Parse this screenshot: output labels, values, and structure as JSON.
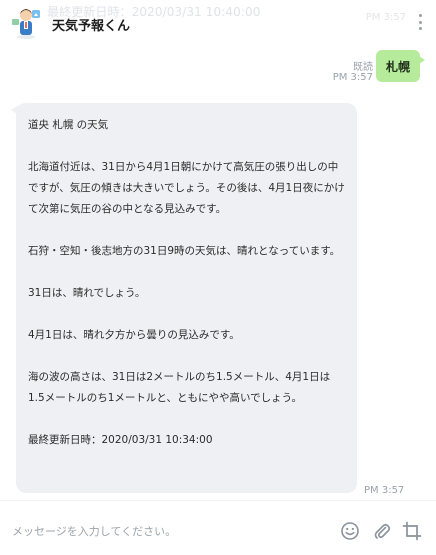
{
  "header": {
    "bot_name": "天気予報くん",
    "ghost_text": "最終更新日時：2020/03/31 10:40:00",
    "ghost_right": "PM 3:57",
    "more_icon": "vertical-ellipsis-icon"
  },
  "user_message": {
    "text": "札幌",
    "read_label": "既読",
    "time": "PM 3:57",
    "bubble_color": "#b7eb9c"
  },
  "bot_message": {
    "paragraphs": [
      "道央 札幌 の天気",
      "北海道付近は、31日から4月1日朝にかけて高気圧の張り出しの中ですが、気圧の傾きは大きいでしょう。その後は、4月1日夜にかけて次第に気圧の谷の中となる見込みです。",
      "石狩・空知・後志地方の31日9時の天気は、晴れとなっています。",
      "31日は、晴れでしょう。",
      "4月1日は、晴れ夕方から曇りの見込みです。",
      "海の波の高さは、31日は2メートルのち1.5メートル、4月1日は1.5メートルのち1メートルと、ともにやや高いでしょう。",
      "最終更新日時：2020/03/31 10:34:00"
    ],
    "time": "PM 3:57",
    "bubble_color": "#eef0f4"
  },
  "input_bar": {
    "placeholder": "メッセージを入力してください。",
    "value": "",
    "icons": [
      "emoji-icon",
      "attachment-icon",
      "crop-icon"
    ]
  }
}
